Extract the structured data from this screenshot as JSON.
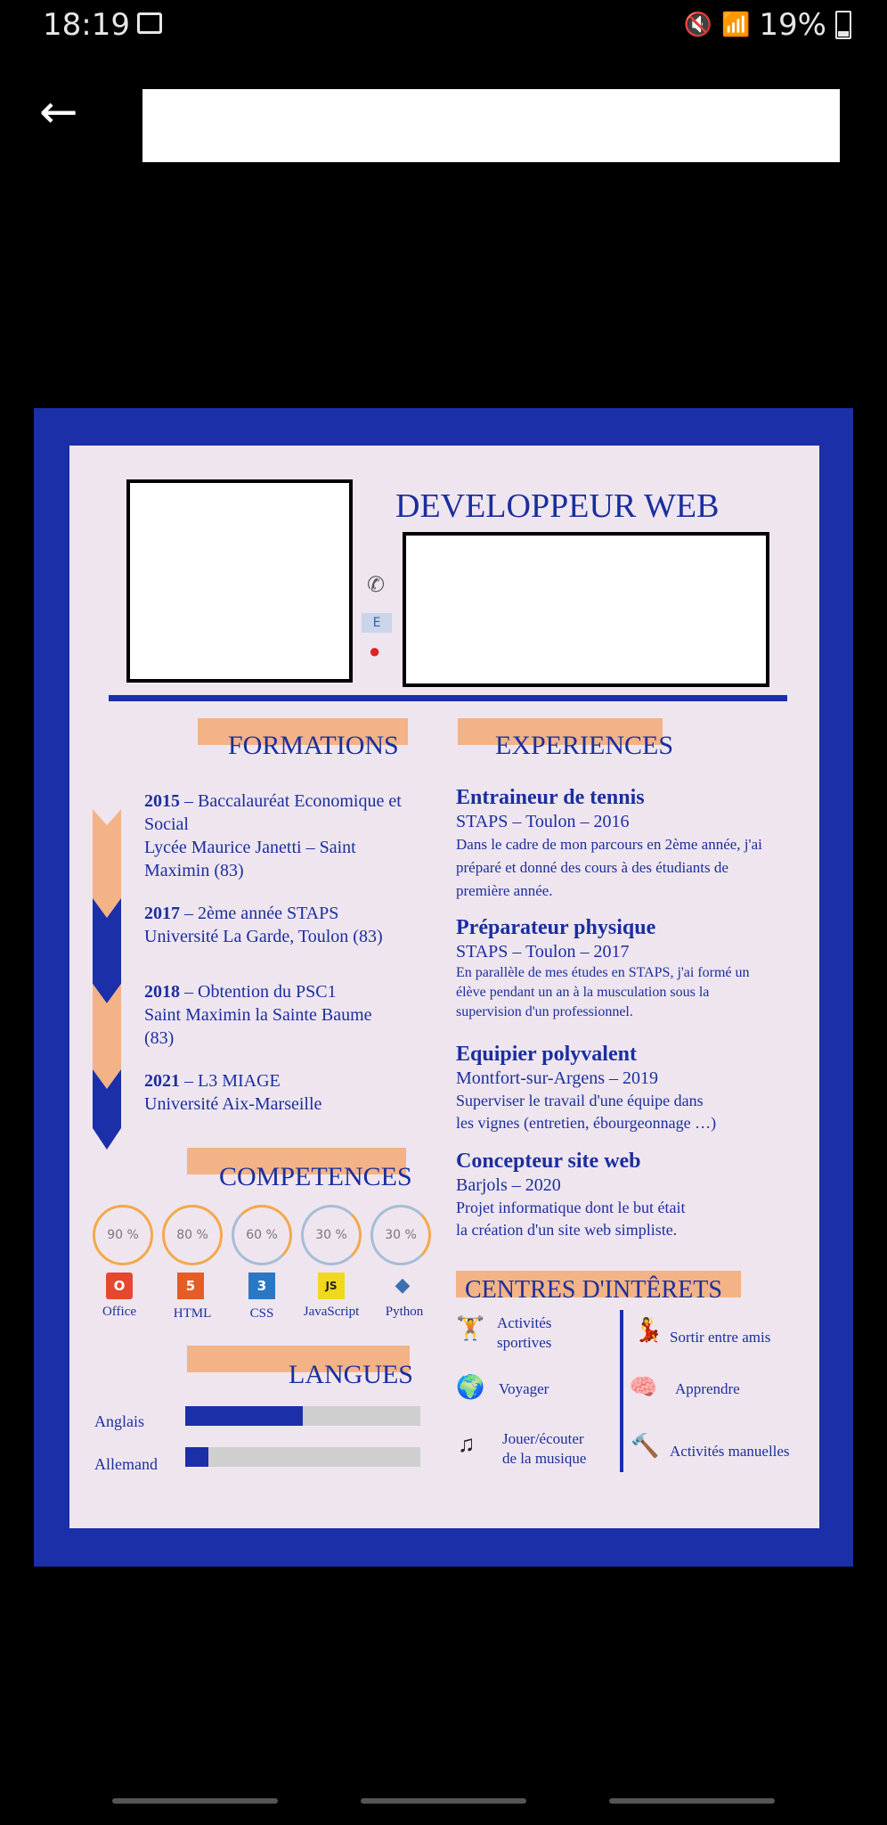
{
  "status_bar": {
    "time": "18:19",
    "battery": "19%"
  },
  "resume": {
    "title": "DEVELOPPEUR WEB",
    "formations": {
      "heading": "FORMATIONS",
      "items": [
        {
          "year": "2015",
          "text": " – Baccalauréat Economique et Social",
          "line2": "Lycée Maurice Janetti – Saint",
          "line3": "Maximin (83)"
        },
        {
          "year": "2017",
          "text": " – 2ème année STAPS",
          "line2": "Université La Garde, Toulon (83)"
        },
        {
          "year": "2018",
          "text": " – Obtention du PSC1",
          "line2": "Saint Maximin la Sainte Baume",
          "line3": "(83)"
        },
        {
          "year": "2021",
          "text": " – L3 MIAGE",
          "line2": "Université Aix-Marseille"
        }
      ]
    },
    "experiences": {
      "heading": "EXPERIENCES",
      "items": [
        {
          "title": "Entraineur de tennis",
          "sub": "STAPS – Toulon – 2016",
          "d1": "Dans le cadre de mon parcours en 2ème année, j'ai",
          "d2": "préparé et donné des cours à des étudiants de",
          "d3": "première année."
        },
        {
          "title": "Préparateur physique",
          "sub": "STAPS – Toulon – 2017",
          "d1": "En parallèle de mes études en STAPS, j'ai formé un",
          "d2": "élève pendant un an à la musculation sous la",
          "d3": "supervision d'un professionnel."
        },
        {
          "title": "Equipier polyvalent",
          "sub": "Montfort-sur-Argens – 2019",
          "d1": "Superviser le travail d'une équipe dans",
          "d2": "les vignes (entretien, ébourgeonnage …)"
        },
        {
          "title": "Concepteur site web",
          "sub": "Barjols – 2020",
          "d1": "Projet informatique dont le but était",
          "d2": "la création d'un site web simpliste."
        }
      ]
    },
    "competences": {
      "heading": "COMPETENCES",
      "skills": [
        {
          "pct": "90 %",
          "name": "Office",
          "level": 0.9
        },
        {
          "pct": "80 %",
          "name": "HTML",
          "level": 0.8
        },
        {
          "pct": "60 %",
          "name": "CSS",
          "level": 0.6
        },
        {
          "pct": "30 %",
          "name": "JavaScript",
          "level": 0.3
        },
        {
          "pct": "30 %",
          "name": "Python",
          "level": 0.3
        }
      ]
    },
    "langues": {
      "heading": "LANGUES",
      "items": [
        {
          "name": "Anglais",
          "level": 0.5
        },
        {
          "name": "Allemand",
          "level": 0.1
        }
      ]
    },
    "interets": {
      "heading": "CENTRES D'INTÊRETS",
      "left": [
        {
          "icon": "weightlifter-icon",
          "l1": "Activités",
          "l2": "sportives"
        },
        {
          "icon": "globe-icon",
          "l1": "Voyager"
        },
        {
          "icon": "music-note-icon",
          "l1": "Jouer/écouter",
          "l2": "de la musique"
        }
      ],
      "right": [
        {
          "icon": "dancer-icon",
          "l1": "Sortir entre amis"
        },
        {
          "icon": "brain-icon",
          "l1": "Apprendre"
        },
        {
          "icon": "tools-icon",
          "l1": "Activités manuelles"
        }
      ]
    }
  }
}
